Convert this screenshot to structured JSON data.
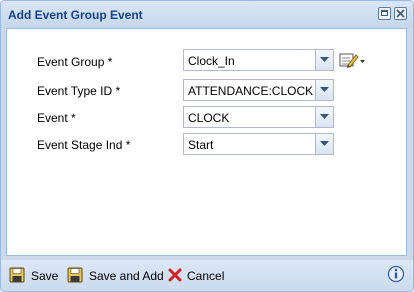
{
  "dialog": {
    "title": "Add Event Group Event"
  },
  "form": {
    "fields": [
      {
        "label": "Event Group *",
        "value": "Clock_In"
      },
      {
        "label": "Event Type ID *",
        "value": "ATTENDANCE:CLOCK"
      },
      {
        "label": "Event *",
        "value": "CLOCK"
      },
      {
        "label": "Event Stage Ind *",
        "value": "Start"
      }
    ]
  },
  "footer": {
    "save_label": "Save",
    "save_and_add_label": "Save and Add",
    "cancel_label": "Cancel"
  },
  "icons": {
    "maximize": "maximize-icon",
    "close": "close-icon",
    "dropdown": "chevron-down-icon",
    "edit": "edit-pencil-icon",
    "save": "floppy-disk-icon",
    "save_and_add": "floppy-disk-add-icon",
    "cancel": "red-x-icon",
    "help": "info-icon"
  }
}
